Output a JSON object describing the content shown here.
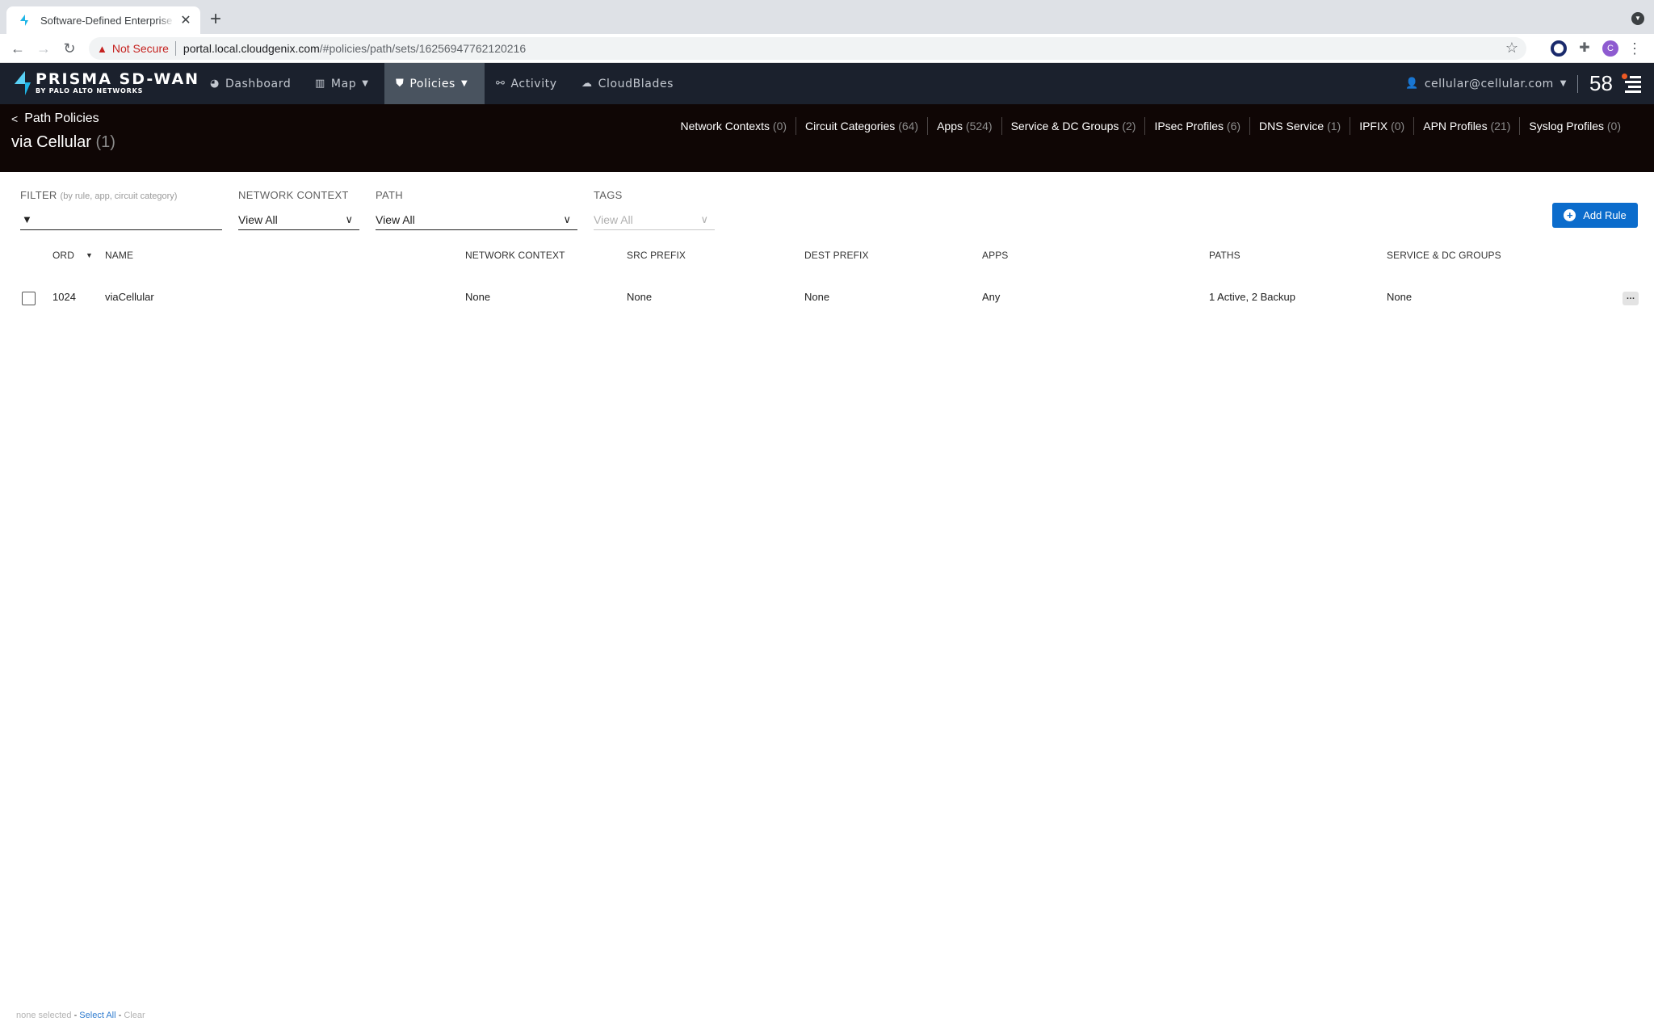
{
  "browser": {
    "tab_title": "Software-Defined Enterprise WAN",
    "new_tab_icon": "plus-icon",
    "url_host": "portal.local.cloudgenix.com",
    "url_path": "/#policies/path/sets/16256947762120216",
    "security_label": "Not Secure",
    "profile_initial": "C"
  },
  "app_nav": {
    "brand": "PRISMA SD-WAN",
    "brand_sub": "BY PALO ALTO NETWORKS",
    "items": [
      {
        "label": "Dashboard",
        "icon": "dashboard-icon"
      },
      {
        "label": "Map",
        "icon": "map-icon"
      },
      {
        "label": "Policies",
        "icon": "shield-icon",
        "active": true
      },
      {
        "label": "Activity",
        "icon": "binoculars-icon"
      },
      {
        "label": "CloudBlades",
        "icon": "cloud-icon"
      }
    ],
    "user": "cellular@cellular.com",
    "notification_count": "58"
  },
  "header": {
    "back_label": "Path Policies",
    "title": "via Cellular",
    "title_count": "(1)",
    "links": [
      {
        "label": "Network Contexts",
        "count": "(0)"
      },
      {
        "label": "Circuit Categories",
        "count": "(64)"
      },
      {
        "label": "Apps",
        "count": "(524)"
      },
      {
        "label": "Service & DC Groups",
        "count": "(2)"
      },
      {
        "label": "IPsec Profiles",
        "count": "(6)"
      },
      {
        "label": "DNS Service",
        "count": "(1)"
      },
      {
        "label": "IPFIX",
        "count": "(0)"
      },
      {
        "label": "APN Profiles",
        "count": "(21)"
      },
      {
        "label": "Syslog Profiles",
        "count": "(0)"
      }
    ]
  },
  "filters": {
    "filter_label": "FILTER",
    "filter_hint": "(by rule, app, circuit category)",
    "filter_value": "",
    "network_context_label": "NETWORK CONTEXT",
    "network_context_value": "View All",
    "path_label": "PATH",
    "path_value": "View All",
    "tags_label": "TAGS",
    "tags_value": "View All",
    "add_rule_label": "Add Rule"
  },
  "table": {
    "columns": [
      "ORD",
      "NAME",
      "NETWORK CONTEXT",
      "SRC PREFIX",
      "DEST PREFIX",
      "APPS",
      "PATHS",
      "SERVICE & DC GROUPS"
    ],
    "sort": {
      "column": "ORD",
      "direction": "desc"
    },
    "rows": [
      {
        "ord": "1024",
        "name": "viaCellular",
        "network_context": "None",
        "src_prefix": "None",
        "dest_prefix": "None",
        "apps": "Any",
        "paths": "1 Active, 2 Backup",
        "service_dc_groups": "None",
        "checked": false
      }
    ]
  },
  "footer": {
    "none_selected": "none selected",
    "sep": "-",
    "select_all": "Select All",
    "clear": "Clear"
  },
  "colors": {
    "nav_bg": "#1b212d",
    "nav_active": "#49535f",
    "header_bg": "#0f0605",
    "accent": "#0b6ccc",
    "link": "#2e7bcf",
    "notification_dot": "#ee5a24"
  }
}
